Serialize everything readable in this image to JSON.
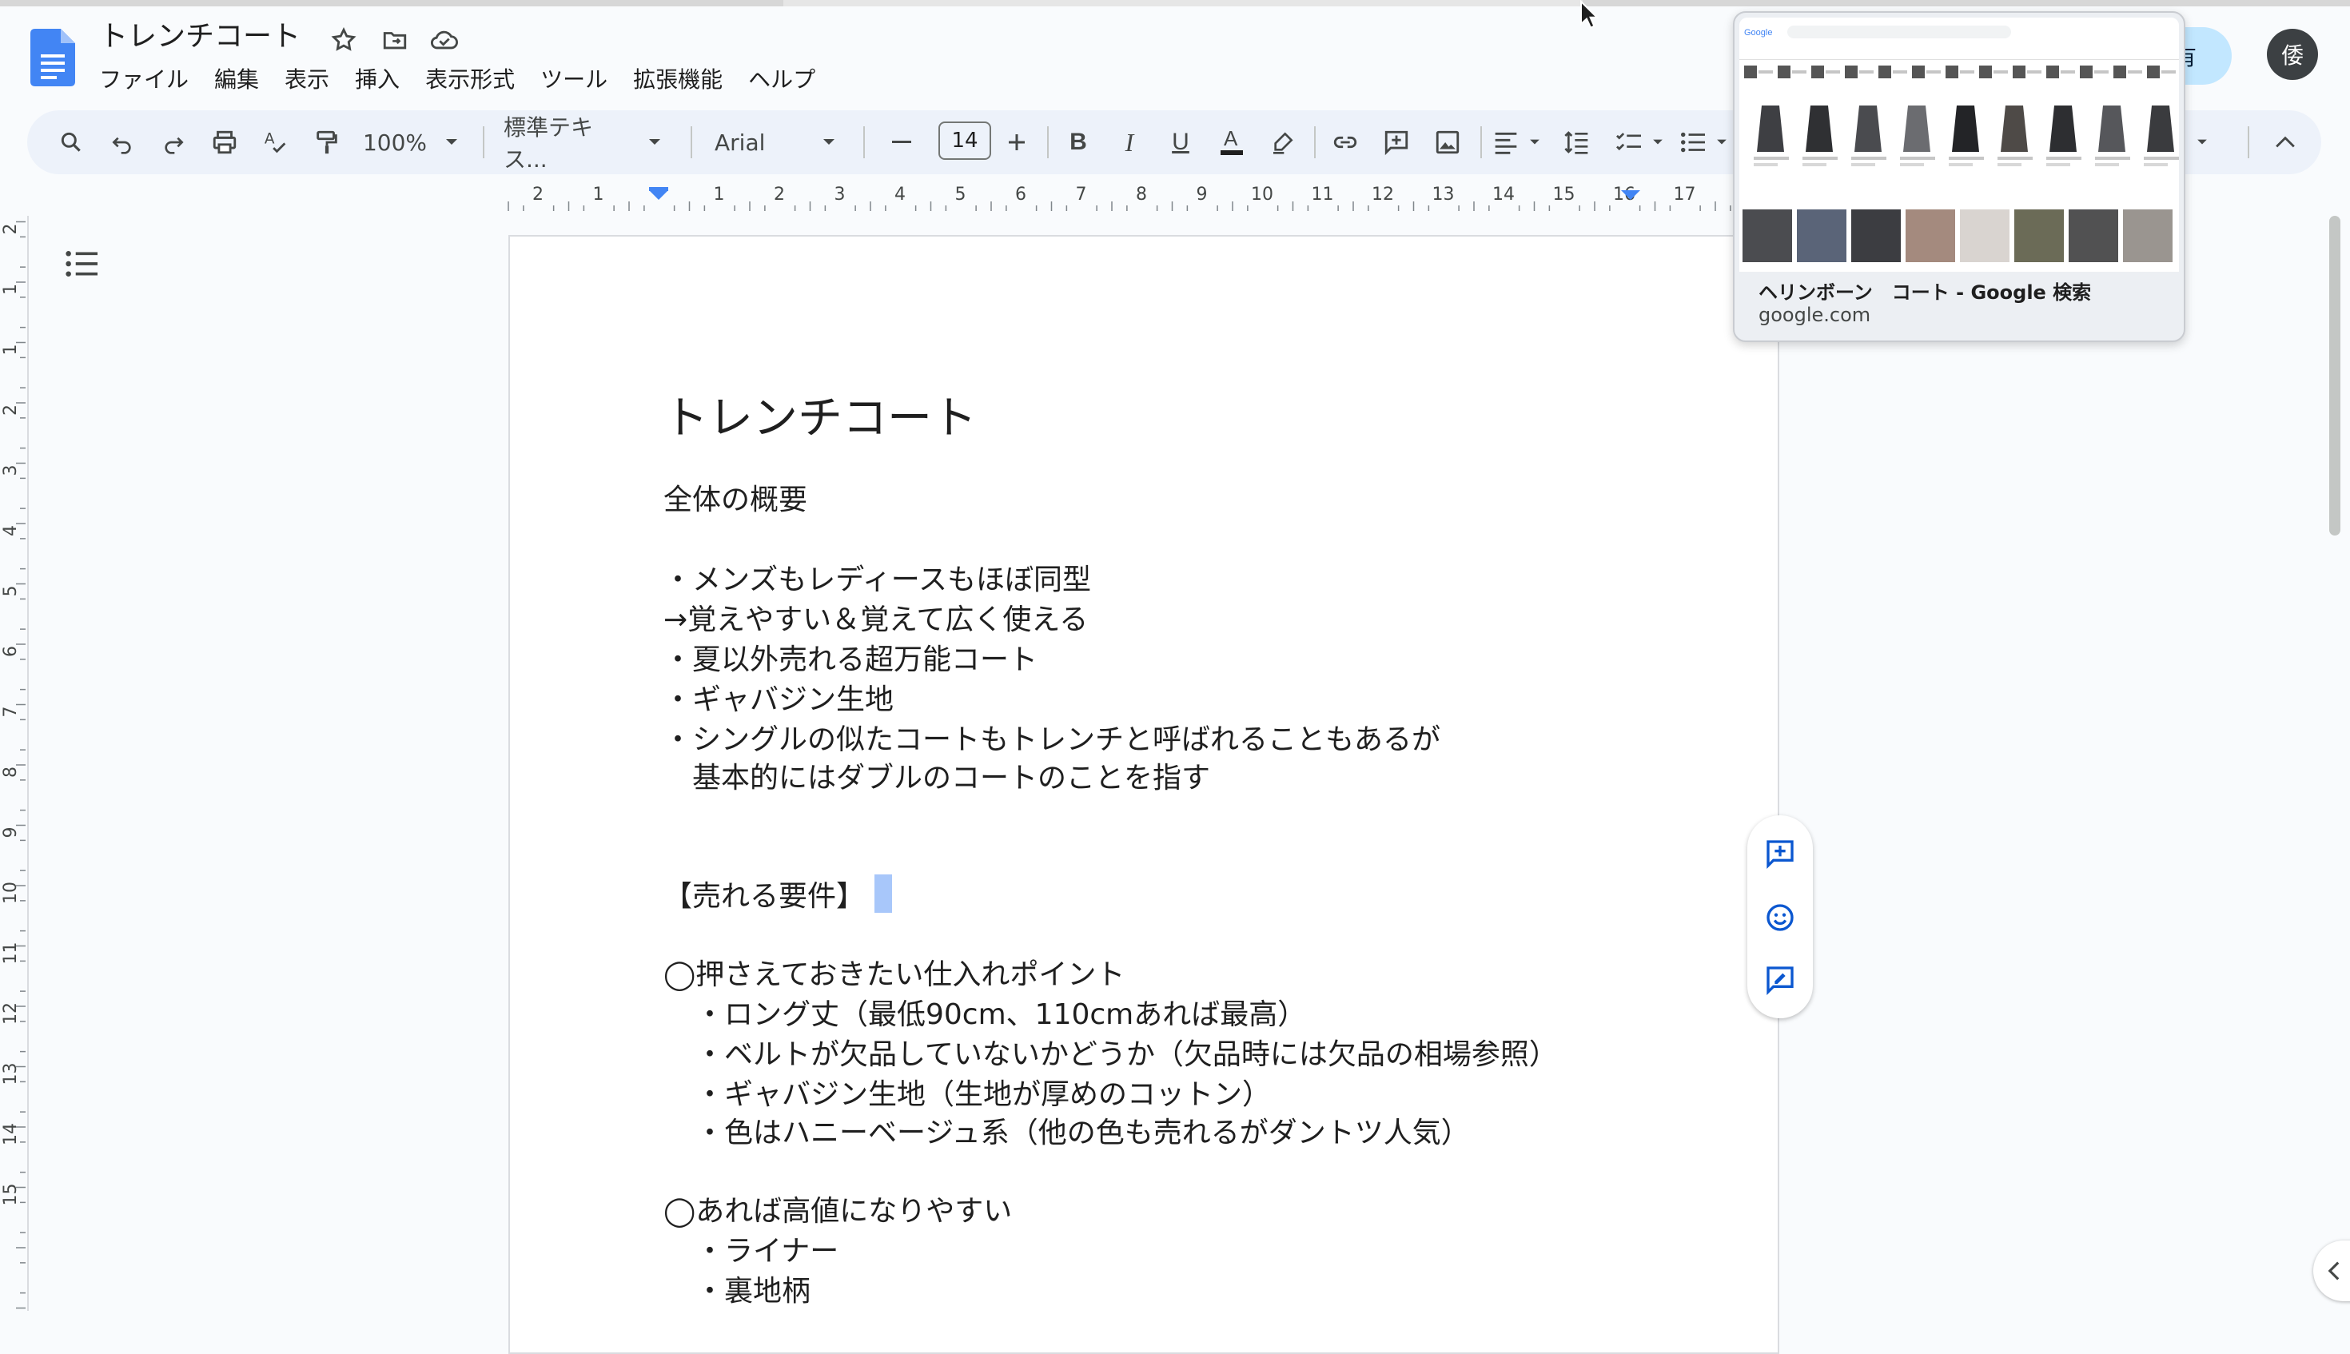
{
  "document": {
    "title": "トレンチコート",
    "menu": [
      "ファイル",
      "編集",
      "表示",
      "挿入",
      "表示形式",
      "ツール",
      "拡張機能",
      "ヘルプ"
    ]
  },
  "toolbar": {
    "zoom": "100%",
    "style": "標準テキス...",
    "font": "Arial",
    "font_size": "14"
  },
  "ruler": {
    "labels": [
      "2",
      "1",
      "1",
      "2",
      "3",
      "4",
      "5",
      "6",
      "7",
      "8",
      "9",
      "10",
      "11",
      "12",
      "13",
      "14",
      "15",
      "16",
      "17"
    ]
  },
  "vruler": {
    "labels": [
      "2",
      "1",
      "1",
      "2",
      "3",
      "4",
      "5",
      "6",
      "7",
      "8",
      "9",
      "10",
      "11",
      "12",
      "13",
      "14",
      "15"
    ]
  },
  "content": {
    "heading": "トレンチコート",
    "overview_label": "全体の概要",
    "lines": [
      "・メンズもレディースもほぼ同型",
      "→覚えやすい＆覚えて広く使える",
      "・夏以外売れる超万能コート",
      "・ギャバジン生地",
      "・シングルの似たコートもトレンチと呼ばれることもあるが",
      "基本的にはダブルのコートのことを指す"
    ],
    "requirements_label": "【売れる要件】",
    "section1_title": "◯押さえておきたい仕入れポイント",
    "section1_items": [
      "・ロング丈（最低90cm、110cmあれば最高）",
      "・ベルトが欠品していないかどうか（欠品時には欠品の相場参照）",
      "・ギャバジン生地（生地が厚めのコットン）",
      "・色はハニーベージュ系（他の色も売れるがダントツ人気）"
    ],
    "section2_title": "◯あれば高値になりやすい",
    "section2_items": [
      "・ライナー",
      "・裏地柄"
    ]
  },
  "preview": {
    "title": "ヘリンボーン　コート - Google 検索",
    "url": "google.com"
  },
  "share": {
    "label": "有"
  },
  "avatar": {
    "initial": "倭"
  }
}
